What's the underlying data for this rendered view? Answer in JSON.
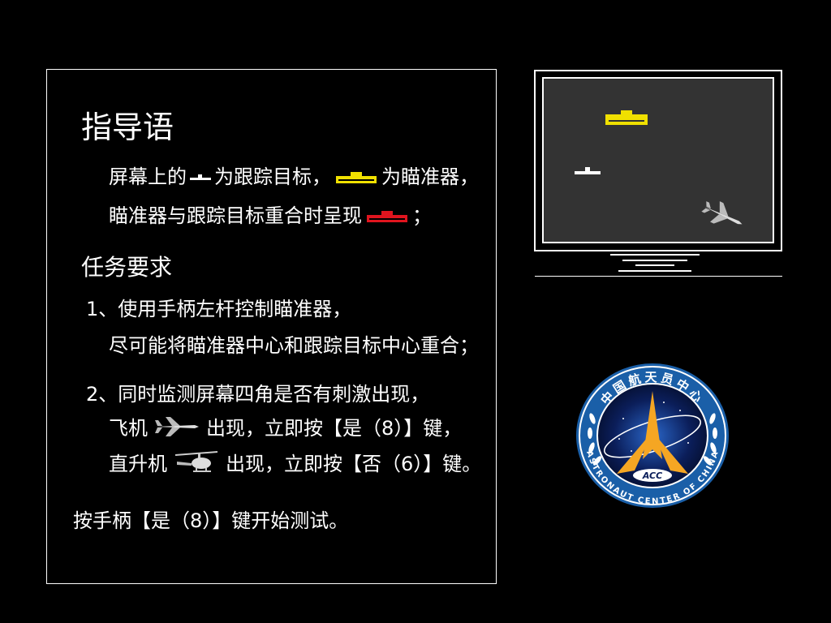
{
  "instructions": {
    "title": "指导语",
    "line1_a": "屏幕上的",
    "line1_b": "为跟踪目标，",
    "line1_c": "为瞄准器，",
    "line2_a": "瞄准器与跟踪目标重合时呈现",
    "line2_b": "；"
  },
  "task": {
    "heading": "任务要求",
    "item1_a": "1、使用手柄左杆控制瞄准器，",
    "item1_b": "尽可能将瞄准器中心和跟踪目标中心重合；",
    "item2_a": "2、同时监测屏幕四角是否有刺激出现，",
    "plane_label": "飞机",
    "plane_action": "出现，立即按【是（8）】键，",
    "heli_label": "直升机",
    "heli_action": "出现，立即按【否（6）】键。"
  },
  "start_prompt": "按手柄【是（8）】键开始测试。",
  "logo": {
    "top_text": "中国航天员中心",
    "bottom_text": "ASTRONAUT CENTER OF CHINA",
    "center_text": "ACC"
  },
  "colors": {
    "background": "#000000",
    "text": "#ffffff",
    "aimer": "#f0e000",
    "aimer_hit": "#e0141e",
    "monitor_screen": "#333333",
    "logo_ring": "#1a5fa8"
  }
}
